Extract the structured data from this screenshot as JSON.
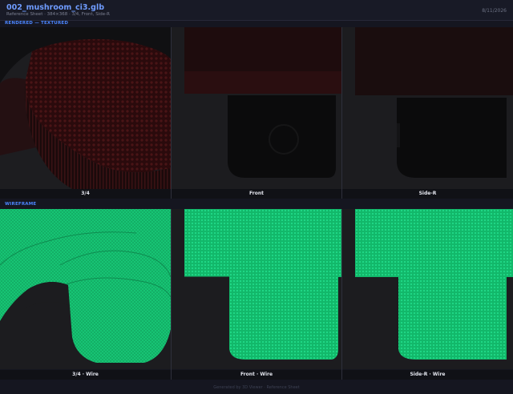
{
  "header": {
    "file_title": "002_mushroom_ci3.glb",
    "subtitle": "Reference Sheet  ·  384×368  ·  3/4, Front, Side-R",
    "date": "8/11/2026"
  },
  "sections": {
    "rendered": "RENDERED — TEXTURED",
    "wireframe": "WIREFRAME"
  },
  "views": {
    "rendered": [
      {
        "label": "3/4"
      },
      {
        "label": "Front"
      },
      {
        "label": "Side-R"
      }
    ],
    "wireframe": [
      {
        "label": "3/4 · Wire"
      },
      {
        "label": "Front · Wire"
      },
      {
        "label": "Side-R · Wire"
      }
    ]
  },
  "colors": {
    "accent": "#4c86ff",
    "wire_green": "#1fcf7a",
    "cap_red": "#3a0d0f",
    "panel_bg": "#1c1c1f"
  },
  "footer": "Generated by 3D Viewer · Reference Sheet"
}
